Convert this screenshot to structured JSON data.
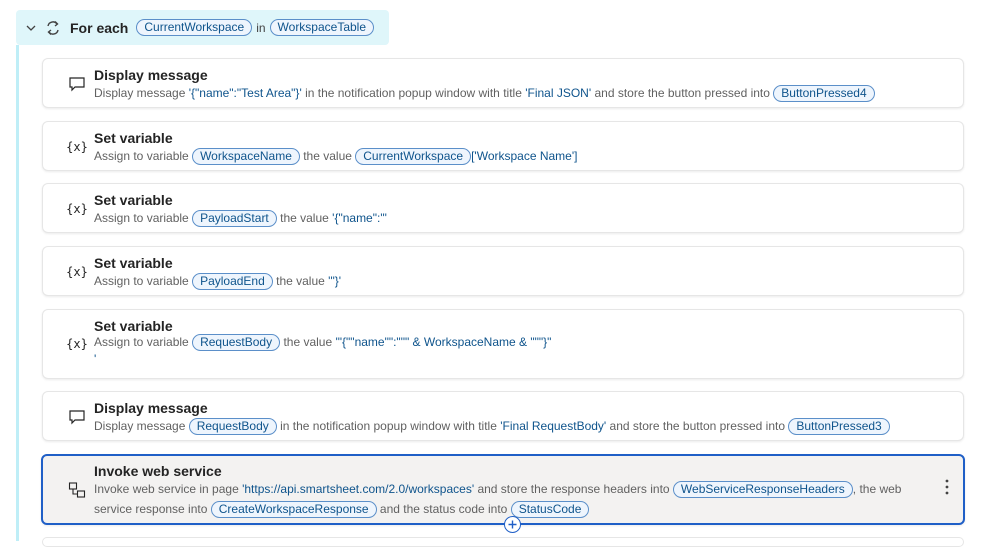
{
  "loop": {
    "title": "For each",
    "variable": "CurrentWorkspace",
    "in_keyword": "in",
    "collection": "WorkspaceTable"
  },
  "actions": [
    {
      "title": "Display message",
      "icon": "message-icon",
      "p1": "Display message ",
      "v1": "'{\"name\":\"Test Area\"}'",
      "p2": " in the notification popup window with title ",
      "v2": "'Final JSON'",
      "p3": " and store the button pressed into ",
      "chip": "ButtonPressed4"
    },
    {
      "title": "Set variable",
      "icon": "variable-icon",
      "icon_text": "{x}",
      "p1": "Assign to variable ",
      "chip1": "WorkspaceName",
      "p2": " the value ",
      "chip2": "CurrentWorkspace",
      "v1": "['Workspace Name']"
    },
    {
      "title": "Set variable",
      "icon": "variable-icon",
      "icon_text": "{x}",
      "p1": "Assign to variable ",
      "chip1": "PayloadStart",
      "p2": " the value ",
      "v1": "'{\"name\":\"'"
    },
    {
      "title": "Set variable",
      "icon": "variable-icon",
      "icon_text": "{x}",
      "p1": "Assign to variable ",
      "chip1": "PayloadEnd",
      "p2": " the value ",
      "v1": "'\"}'"
    },
    {
      "title": "Set variable",
      "icon": "variable-icon",
      "icon_text": "{x}",
      "p1": "Assign to variable ",
      "chip1": "RequestBody",
      "p2": " the value ",
      "v1": "'\"{\"\"name\"\":\"\"\" & WorkspaceName & \"\"\"}\"",
      "v2": "'"
    },
    {
      "title": "Display message",
      "icon": "message-icon",
      "p1": "Display message ",
      "chip1": "RequestBody",
      "p2": " in the notification popup window with title ",
      "v1": "'Final RequestBody'",
      "p3": " and store the button pressed into ",
      "chip2": "ButtonPressed3"
    },
    {
      "title": "Invoke web service",
      "icon": "web-service-icon",
      "p1": "Invoke web service in page ",
      "v1": "'https://api.smartsheet.com/2.0/workspaces'",
      "p2": " and store the response headers into ",
      "chip1": "WebServiceResponseHeaders",
      "p3": ", the web service response into ",
      "chip2": "CreateWorkspaceResponse",
      "p4": " and the status code into ",
      "chip3": "StatusCode"
    }
  ]
}
